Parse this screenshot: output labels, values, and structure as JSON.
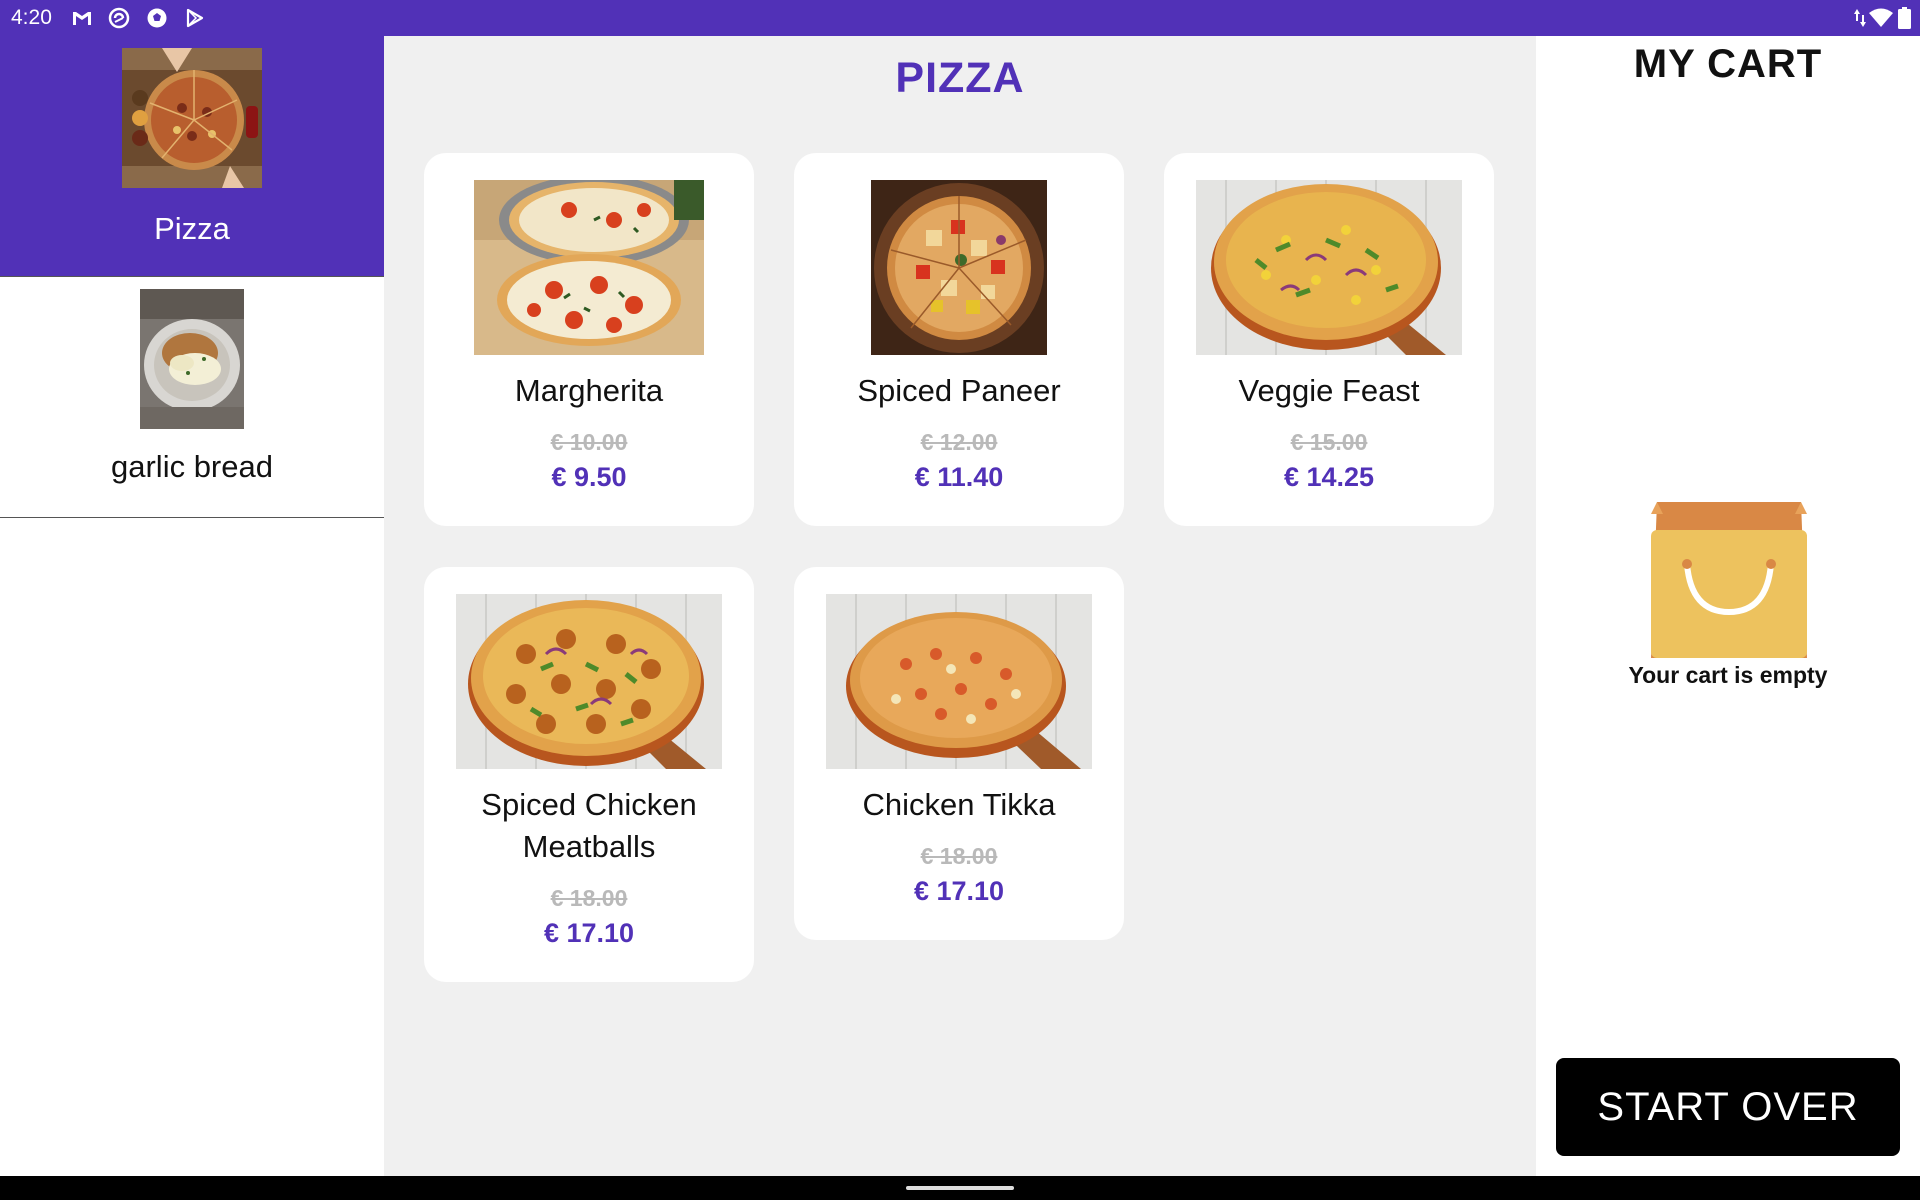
{
  "status_bar": {
    "time": "4:20",
    "left_icons": [
      "gmail-icon",
      "sync-icon",
      "soccer-ball-icon",
      "play-store-icon"
    ],
    "right_icons": [
      "data-arrows-icon",
      "wifi-icon",
      "battery-icon"
    ]
  },
  "sidebar": {
    "items": [
      {
        "label": "Pizza",
        "active": true
      },
      {
        "label": "garlic bread",
        "active": false
      }
    ]
  },
  "main": {
    "category_title": "PIZZA",
    "products": [
      {
        "name": "Margherita",
        "old_price": "€ 10.00",
        "price": "€ 9.50"
      },
      {
        "name": "Spiced Paneer",
        "old_price": "€ 12.00",
        "price": "€ 11.40"
      },
      {
        "name": "Veggie Feast",
        "old_price": "€ 15.00",
        "price": "€ 14.25"
      },
      {
        "name": "Spiced Chicken Meatballs",
        "old_price": "€ 18.00",
        "price": "€ 17.10"
      },
      {
        "name": "Chicken Tikka",
        "old_price": "€ 18.00",
        "price": "€ 17.10"
      }
    ]
  },
  "cart": {
    "title": "MY CART",
    "empty_text": "Your cart is empty",
    "start_over_label": "START OVER"
  },
  "colors": {
    "brand": "#5131B7",
    "background": "#F0F0F0",
    "old_price": "#B9B9B9",
    "bag": "#EDC25E",
    "bag_top": "#D98845"
  }
}
